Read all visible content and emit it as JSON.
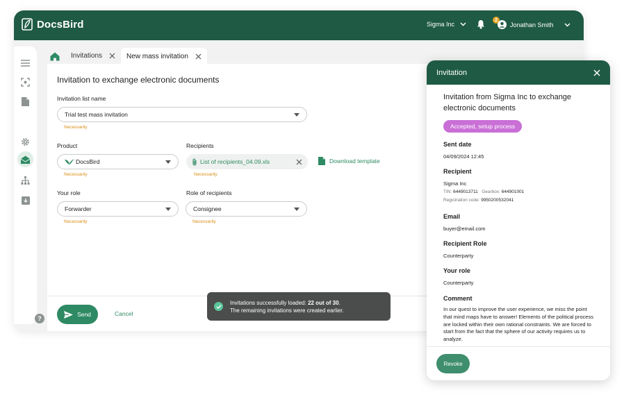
{
  "header": {
    "brand": "DocsBird",
    "company": "Sigma Inc",
    "notification_count": "2",
    "user_name": "Jonathan Smith"
  },
  "tabs": [
    {
      "label": "Invitations"
    },
    {
      "label": "New mass invitation"
    }
  ],
  "form": {
    "title": "Invitation to exchange electronic documents",
    "list_name_label": "Invitation list name",
    "list_name_value": "Trial test mass invitation",
    "required_hint": "Necessarily",
    "product_label": "Product",
    "product_value": "DocsBird",
    "recipients_label": "Recipients",
    "recipients_file": "List of recipients_04.09.xls",
    "download_template": "Download template",
    "role_label": "Your role",
    "role_value": "Forwarder",
    "recipient_role_label": "Role of recipients",
    "recipient_role_value": "Consignee",
    "send_label": "Send",
    "cancel_label": "Cancel"
  },
  "toast": {
    "line1_prefix": "Invitations successfully loaded: ",
    "line1_bold": "22 out of 30",
    "line1_suffix": ".",
    "line2": "The remaining invitations were created earlier."
  },
  "modal": {
    "title": "Invitation",
    "heading": "Invitation from Sigma Inc to exchange electronic documents",
    "status": "Accepted, setup process",
    "sent_date_label": "Sent date",
    "sent_date_value": "04/09/2024 12:45",
    "recipient_label": "Recipient",
    "recipient_name": "Sigma Inc",
    "tin_label": "TIN:",
    "tin_value": "6449013711",
    "gearbox_label": "Gearbox:",
    "gearbox_value": "644901001",
    "reg_label": "Registration code:",
    "reg_value": "9950200532041",
    "email_label": "Email",
    "email_value": "buyer@email.com",
    "recipient_role_label": "Recipient Role",
    "recipient_role_value": "Counterparty",
    "your_role_label": "Your role",
    "your_role_value": "Counterparty",
    "comment_label": "Comment",
    "comment_text": "In our quest to improve the user experience, we miss the point that mind maps have to answer! Elements of the political process are locked within their own rational constraints. We are forced to start from the fact that the sphere of our activity requires us to analyze.",
    "revoke_label": "Revoke"
  },
  "colors": {
    "brand_dark": "#1f5a44",
    "accent": "#2e8a63",
    "warning": "#d98e16",
    "status_purple": "#c96fd6"
  }
}
